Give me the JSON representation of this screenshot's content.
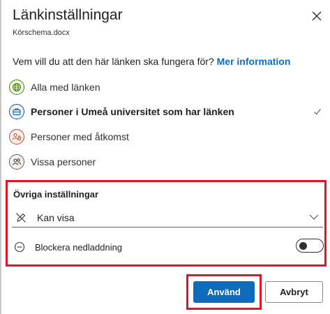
{
  "dialog": {
    "title": "Länkinställningar",
    "filename": "Körschema.docx",
    "question": "Vem vill du att den här länken ska fungera för?",
    "more_info_link": "Mer information"
  },
  "options": [
    {
      "label": "Alla med länken",
      "icon": "globe-icon",
      "selected": false
    },
    {
      "label": "Personer i Umeå universitet som har länken",
      "icon": "organization-icon",
      "selected": true
    },
    {
      "label": "Personer med åtkomst",
      "icon": "people-access-icon",
      "selected": false
    },
    {
      "label": "Vissa personer",
      "icon": "specific-people-icon",
      "selected": false
    }
  ],
  "other_settings": {
    "title": "Övriga inställningar",
    "permission": "Kan visa",
    "block_download_label": "Blockera nedladdning",
    "block_download_enabled": false
  },
  "buttons": {
    "apply": "Använd",
    "cancel": "Avbryt"
  },
  "colors": {
    "accent": "#0f6cbd",
    "highlight": "#e81123"
  }
}
